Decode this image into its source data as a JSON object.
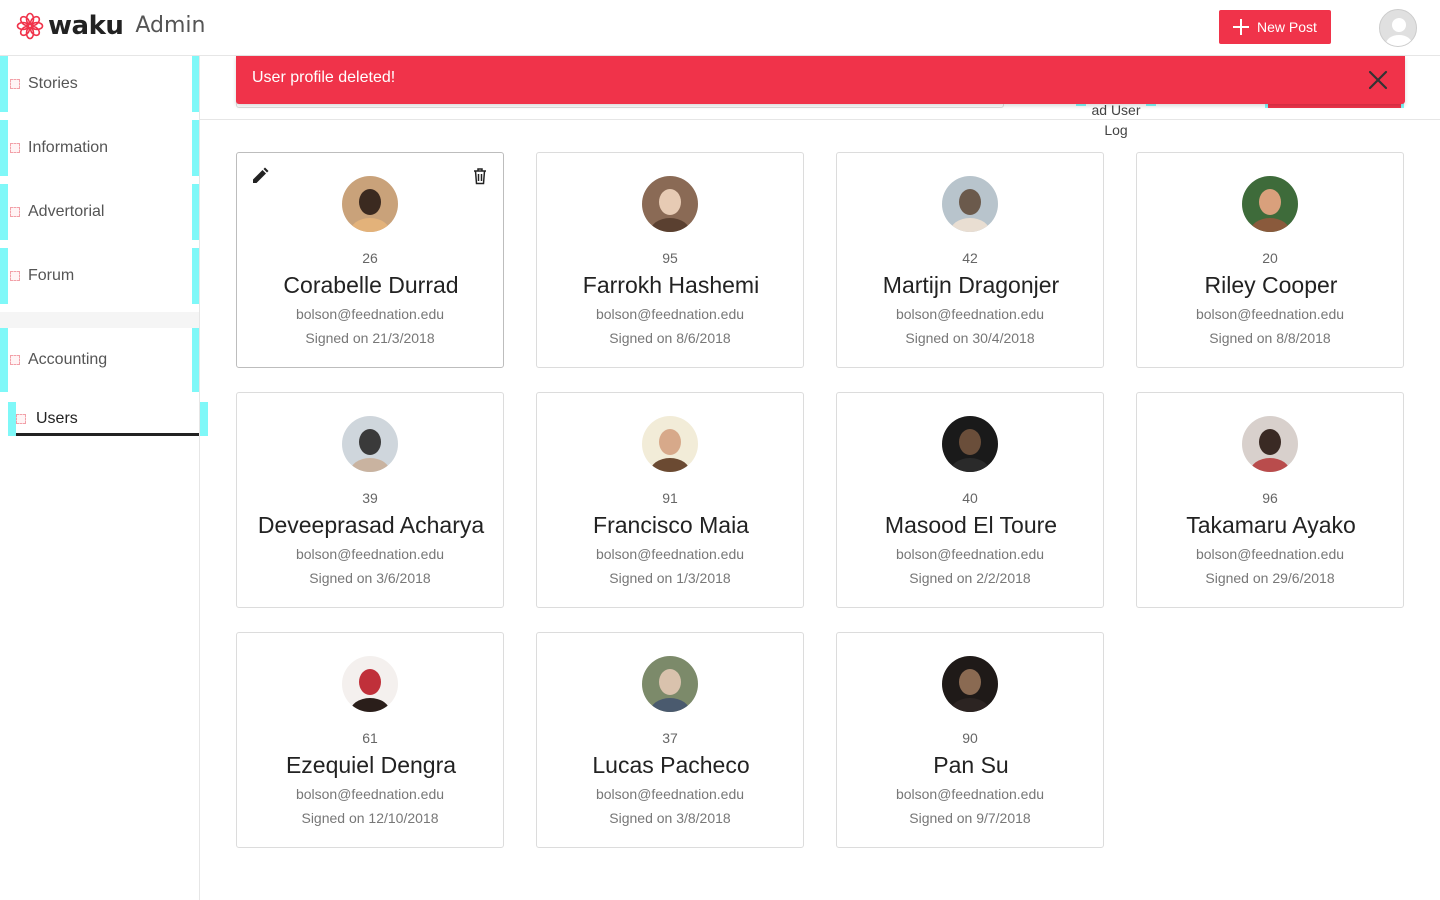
{
  "header": {
    "brand": "waku",
    "brand_suffix": "Admin",
    "new_post_label": "New Post",
    "brand_color": "#f0334a"
  },
  "sidebar": {
    "items": [
      {
        "label": "Stories",
        "icon": "stories-icon"
      },
      {
        "label": "Information",
        "icon": "information-icon"
      },
      {
        "label": "Advertorial",
        "icon": "advertorial-icon"
      },
      {
        "label": "Forum",
        "icon": "forum-icon"
      },
      {
        "label": "Accounting",
        "icon": "accounting-icon"
      },
      {
        "label": "Users",
        "icon": "users-icon",
        "active": true
      }
    ]
  },
  "toolbar": {
    "load_log_line1": "ad User",
    "load_log_line2": "Log"
  },
  "toast": {
    "message": "User profile deleted!",
    "color": "#f0334a"
  },
  "users": [
    {
      "number": "26",
      "name": "Corabelle Durrad",
      "email": "bolson@feednation.edu",
      "signed": "Signed on 21/3/2018",
      "selected": true
    },
    {
      "number": "95",
      "name": "Farrokh Hashemi",
      "email": "bolson@feednation.edu",
      "signed": "Signed on 8/6/2018"
    },
    {
      "number": "42",
      "name": "Martijn Dragonjer",
      "email": "bolson@feednation.edu",
      "signed": "Signed on 30/4/2018"
    },
    {
      "number": "20",
      "name": "Riley Cooper",
      "email": "bolson@feednation.edu",
      "signed": "Signed on 8/8/2018"
    },
    {
      "number": "39",
      "name": "Deveeprasad Acharya",
      "email": "bolson@feednation.edu",
      "signed": "Signed on 3/6/2018"
    },
    {
      "number": "91",
      "name": "Francisco Maia",
      "email": "bolson@feednation.edu",
      "signed": "Signed on 1/3/2018"
    },
    {
      "number": "40",
      "name": "Masood El Toure",
      "email": "bolson@feednation.edu",
      "signed": "Signed on 2/2/2018"
    },
    {
      "number": "96",
      "name": "Takamaru Ayako",
      "email": "bolson@feednation.edu",
      "signed": "Signed on 29/6/2018"
    },
    {
      "number": "61",
      "name": "Ezequiel Dengra",
      "email": "bolson@feednation.edu",
      "signed": "Signed on 12/10/2018"
    },
    {
      "number": "37",
      "name": "Lucas Pacheco",
      "email": "bolson@feednation.edu",
      "signed": "Signed on 3/8/2018"
    },
    {
      "number": "90",
      "name": "Pan Su",
      "email": "bolson@feednation.edu",
      "signed": "Signed on 9/7/2018"
    }
  ]
}
